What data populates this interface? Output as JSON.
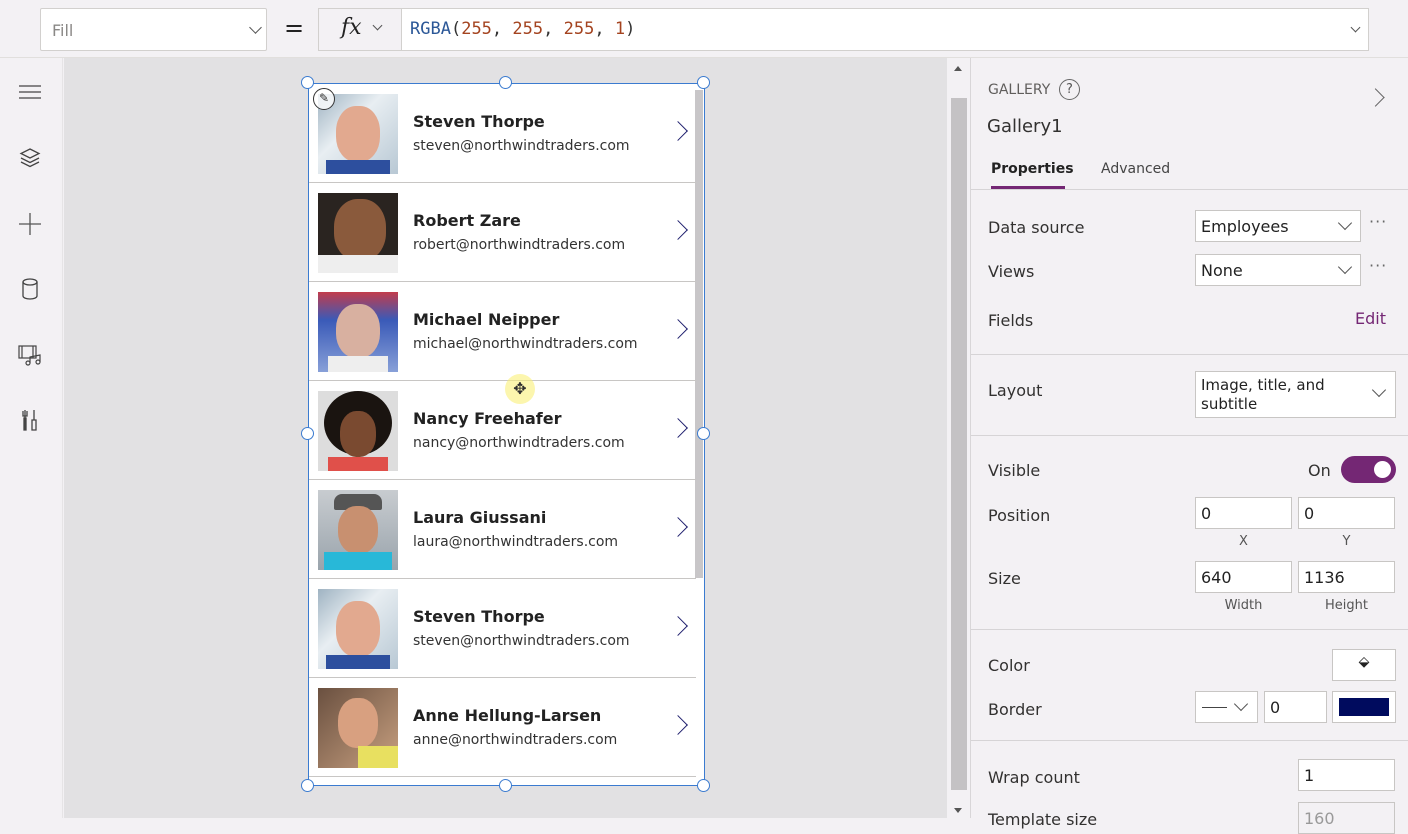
{
  "formula_bar": {
    "property": "Fill",
    "equals": "=",
    "fx": "fx",
    "formula": {
      "fn": "RGBA",
      "open": "(",
      "args": [
        "255",
        ", ",
        "255",
        ", ",
        "255",
        ", ",
        "1"
      ],
      "close": ")"
    }
  },
  "rail": {
    "icons": [
      "hamburger-menu-icon",
      "layers-icon",
      "plus-icon",
      "database-icon",
      "media-icon",
      "tools-icon"
    ]
  },
  "gallery": {
    "items": [
      {
        "name": "Steven Thorpe",
        "email": "steven@northwindtraders.com"
      },
      {
        "name": "Robert Zare",
        "email": "robert@northwindtraders.com"
      },
      {
        "name": "Michael Neipper",
        "email": "michael@northwindtraders.com"
      },
      {
        "name": "Nancy Freehafer",
        "email": "nancy@northwindtraders.com"
      },
      {
        "name": "Laura Giussani",
        "email": "laura@northwindtraders.com"
      },
      {
        "name": "Steven Thorpe",
        "email": "steven@northwindtraders.com"
      },
      {
        "name": "Anne Hellung-Larsen",
        "email": "anne@northwindtraders.com"
      }
    ]
  },
  "panel": {
    "type": "GALLERY",
    "control_name": "Gallery1",
    "tabs": [
      "Properties",
      "Advanced"
    ],
    "active_tab": "Properties",
    "data_source": {
      "label": "Data source",
      "value": "Employees"
    },
    "views": {
      "label": "Views",
      "value": "None"
    },
    "fields": {
      "label": "Fields",
      "action": "Edit"
    },
    "layout": {
      "label": "Layout",
      "value": "Image, title, and subtitle"
    },
    "visible": {
      "label": "Visible",
      "state": "On"
    },
    "position": {
      "label": "Position",
      "x": "0",
      "y": "0",
      "x_cap": "X",
      "y_cap": "Y"
    },
    "size": {
      "label": "Size",
      "width": "640",
      "height": "1136",
      "w_cap": "Width",
      "h_cap": "Height"
    },
    "color": {
      "label": "Color"
    },
    "border": {
      "label": "Border",
      "width": "0",
      "color": "#000b5e"
    },
    "wrap_count": {
      "label": "Wrap count",
      "value": "1"
    },
    "template_size": {
      "label": "Template size",
      "value": "160"
    },
    "ellipsis": "···",
    "accent": "#742774"
  }
}
